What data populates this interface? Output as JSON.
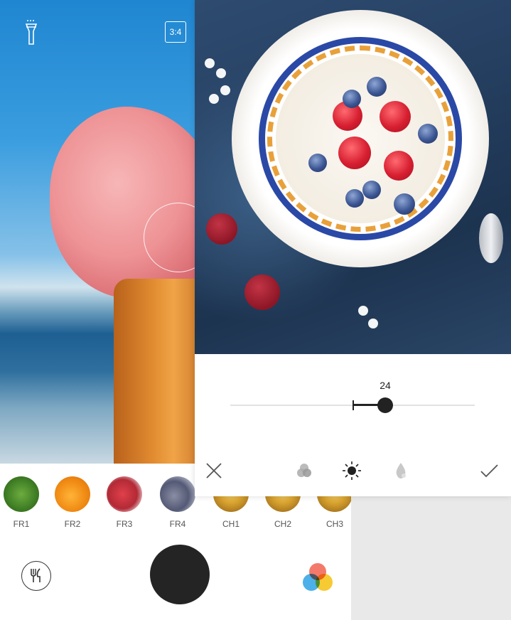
{
  "camera": {
    "ratio_label": "3:4",
    "filters": [
      {
        "label": "FR1"
      },
      {
        "label": "FR2"
      },
      {
        "label": "FR3"
      },
      {
        "label": "FR4"
      },
      {
        "label": "CH1"
      },
      {
        "label": "CH2"
      },
      {
        "label": "CH3"
      }
    ],
    "food_mode_icon": "fork-knife-icon",
    "color_filter_icon": "color-circles-icon",
    "shutter_icon": "shutter-button"
  },
  "editor": {
    "slider_value": "24",
    "toolbar": {
      "cancel_icon": "close-icon",
      "filter_icon": "filter-circles-icon",
      "brightness_icon": "brightness-icon",
      "saturation_icon": "drop-icon",
      "confirm_icon": "check-icon"
    }
  }
}
